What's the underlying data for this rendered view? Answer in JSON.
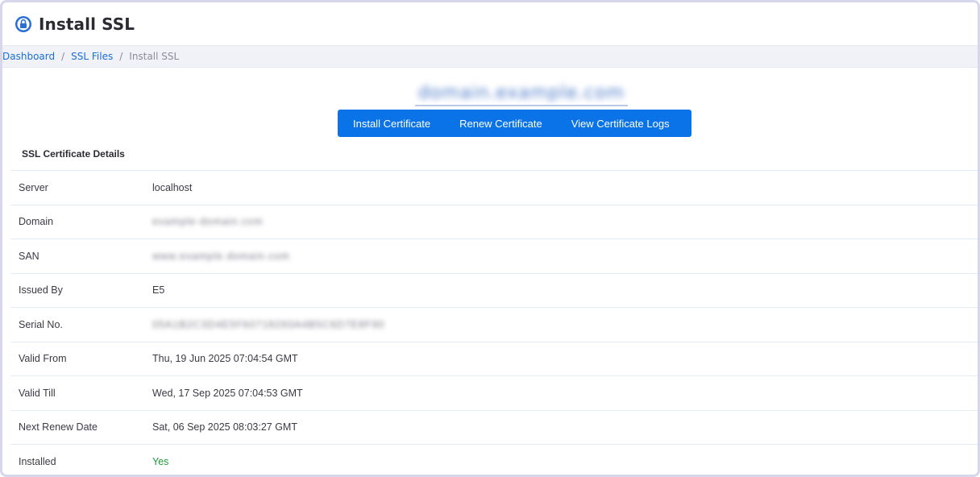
{
  "header": {
    "title": "Install SSL",
    "icon": "lock-icon"
  },
  "breadcrumb": {
    "items": [
      "Dashboard",
      "SSL Files"
    ],
    "current": "Install SSL"
  },
  "domain_display": {
    "text": "domain.example.com"
  },
  "actions": {
    "install_label": "Install Certificate",
    "renew_label": "Renew Certificate",
    "logs_label": "View Certificate Logs"
  },
  "details": {
    "title": "SSL Certificate Details",
    "rows": [
      {
        "label": "Server",
        "value": "localhost"
      },
      {
        "label": "Domain",
        "value": "example-domain.com"
      },
      {
        "label": "SAN",
        "value": "www.example.domain.com"
      },
      {
        "label": "Issued By",
        "value": "E5"
      },
      {
        "label": "Serial No.",
        "value": "05A1B2C3D4E5F60718293A4B5C6D7E8F90"
      },
      {
        "label": "Valid From",
        "value": "Thu, 19 Jun 2025 07:04:54 GMT"
      },
      {
        "label": "Valid Till",
        "value": "Wed, 17 Sep 2025 07:04:53 GMT"
      },
      {
        "label": "Next Renew Date",
        "value": "Sat, 06 Sep 2025 08:03:27 GMT"
      },
      {
        "label": "Installed",
        "value": "Yes"
      }
    ]
  },
  "colors": {
    "accent": "#0a73e8",
    "link": "#1a6fd4",
    "success": "#1f9a3a"
  }
}
